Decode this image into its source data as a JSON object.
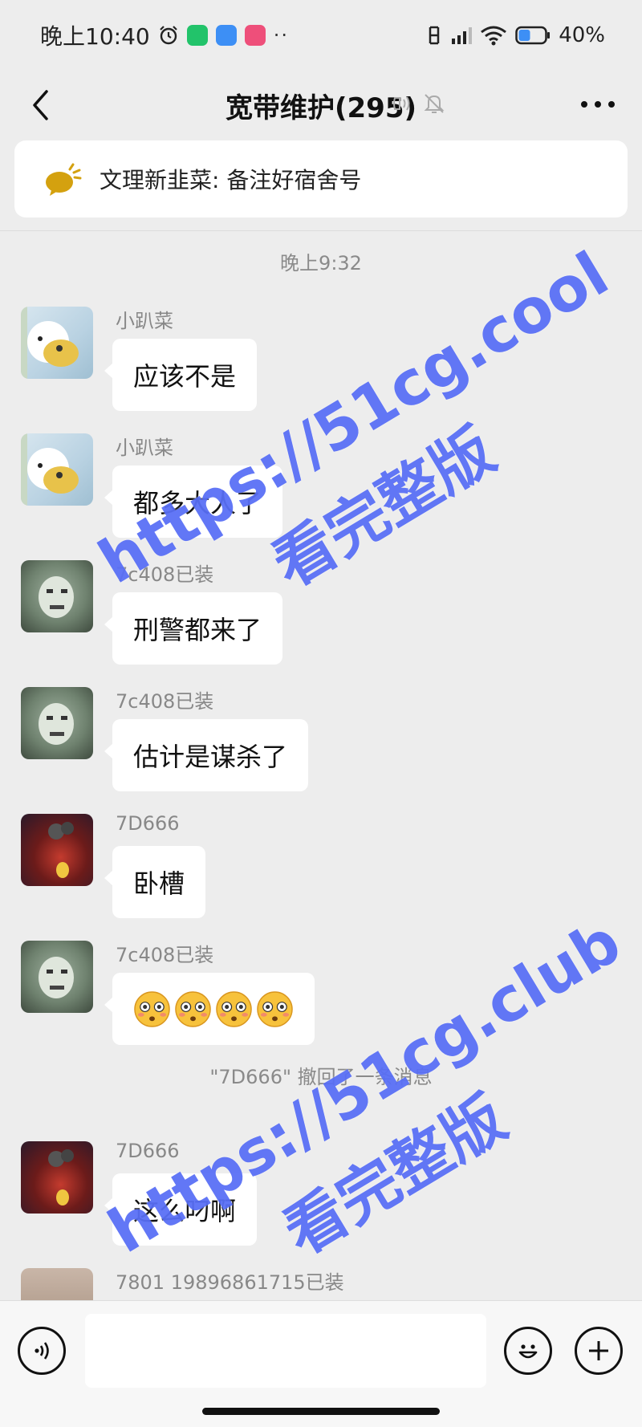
{
  "status_bar": {
    "time": "晚上10:40",
    "battery": "40%",
    "icons": [
      "alarm-icon",
      "wechat-app-icon",
      "qq-browser-icon",
      "douyin-icon",
      "more-dots",
      "nfc-icon",
      "signal-icon",
      "wifi-icon",
      "battery-icon"
    ]
  },
  "header": {
    "title": "宽带维护(295)",
    "icons": [
      "back-icon",
      "earpiece-icon",
      "mute-icon",
      "more-icon"
    ]
  },
  "announcement": {
    "text": "文理新韭菜: 备注好宿舍号",
    "icon": "announcement-icon"
  },
  "timestamp": "晚上9:32",
  "messages": [
    {
      "sender": "小趴菜",
      "text": "应该不是",
      "avatar": "bear-avatar"
    },
    {
      "sender": "小趴菜",
      "text": "都多大人了",
      "avatar": "bear-avatar"
    },
    {
      "sender": "7c408已装",
      "text": "刑警都来了",
      "avatar": "meme-avatar"
    },
    {
      "sender": "7c408已装",
      "text": "估计是谋杀了",
      "avatar": "meme-avatar"
    },
    {
      "sender": "7D666",
      "text": "卧槽",
      "avatar": "motorcycle-avatar"
    },
    {
      "sender": "7c408已装",
      "emojis": [
        "flushed-emoji",
        "flushed-emoji",
        "flushed-emoji",
        "flushed-emoji"
      ],
      "avatar": "meme-avatar"
    },
    {
      "sender": "7D666",
      "text": "这么叼啊",
      "avatar": "motorcycle-avatar"
    },
    {
      "sender": "7801 19896861715已装",
      "text": "",
      "avatar": "plain-avatar"
    }
  ],
  "system_note": "\"7D666\" 撤回了一条消息",
  "watermarks": [
    {
      "url": "https://51cg.cool",
      "label": "看完整版"
    },
    {
      "url": "https://51cg.club",
      "label": "看完整版"
    }
  ],
  "input_bar": {
    "placeholder": "",
    "icons": [
      "voice-icon",
      "emoji-icon",
      "plus-icon"
    ]
  }
}
